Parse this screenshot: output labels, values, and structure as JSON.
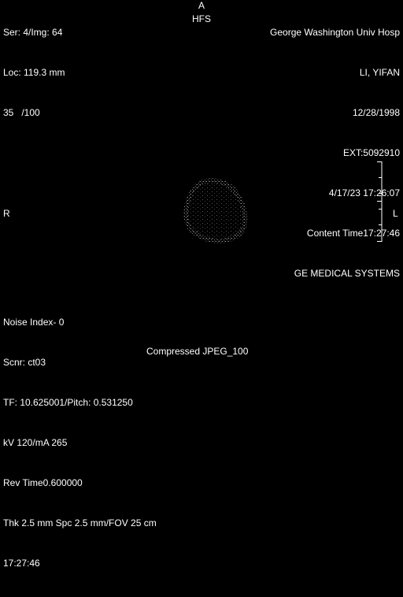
{
  "top_left": {
    "series_image": "Ser: 4/Img: 64",
    "location": "Loc: 119.3 mm",
    "window": "35   /100"
  },
  "top_center": {
    "orientation": "A",
    "patient_position": "HFS"
  },
  "top_right": {
    "institution": "George Washington Univ Hosp",
    "patient_name": "LI, YIFAN",
    "dob": "12/28/1998",
    "exam": "EXT:5092910",
    "datetime": "4/17/23 17:26:07",
    "content_time": "Content Time17:27:46",
    "manufacturer": "GE MEDICAL SYSTEMS"
  },
  "orientation": {
    "right": "R",
    "left": "L"
  },
  "bottom_left": {
    "noise_index": "Noise Index- 0",
    "scanner": "Scnr: ct03",
    "tf_pitch": "TF: 10.625001/Pitch: 0.531250",
    "kv_ma": "kV 120/mA 265",
    "rev_time": "Rev Time0.600000",
    "thickness": "Thk 2.5 mm Spc 2.5 mm/FOV 25 cm",
    "time": "17:27:46"
  },
  "compression": "Compressed JPEG_100",
  "colors": {
    "background": "#000000",
    "text": "#ffffff",
    "tissue": "#8a8a8a"
  }
}
